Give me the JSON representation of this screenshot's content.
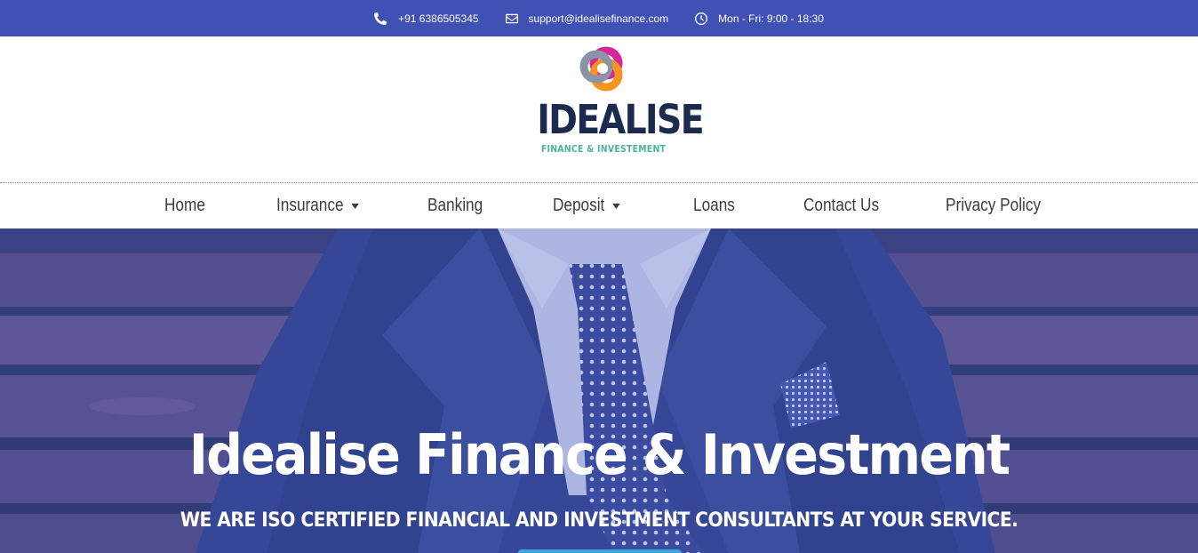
{
  "topbar": {
    "phone": "+91 6386505345",
    "email": "support@idealisefinance.com",
    "hours": "Mon - Fri: 9:00 - 18:30",
    "background": "#3f51b5"
  },
  "logo": {
    "wordmark": "IDEALISE",
    "tagline": "FINANCE & INVESTEMENT"
  },
  "nav": {
    "items": [
      {
        "label": "Home",
        "has_dropdown": false
      },
      {
        "label": "Insurance",
        "has_dropdown": true
      },
      {
        "label": "Banking",
        "has_dropdown": false
      },
      {
        "label": "Deposit",
        "has_dropdown": true
      },
      {
        "label": "Loans",
        "has_dropdown": false
      },
      {
        "label": "Contact Us",
        "has_dropdown": false
      },
      {
        "label": "Privacy Policy",
        "has_dropdown": false
      }
    ]
  },
  "hero": {
    "title": "Idealise Finance & Investment",
    "subtitle": "WE ARE ISO CERTIFIED FINANCIAL AND INVESTMENT CONSULTANTS AT YOUR SERVICE.",
    "overlay_color": "#3f51b5",
    "button_color": "#3aa6d8"
  }
}
